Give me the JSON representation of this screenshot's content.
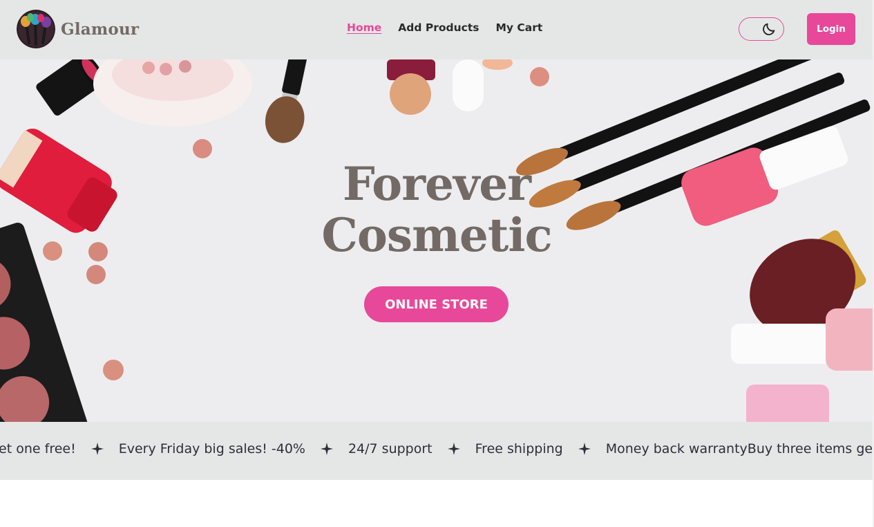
{
  "brand": {
    "name": "Glamour",
    "logo_icon": "makeup-brushes-logo"
  },
  "nav": {
    "links": [
      {
        "label": "Home",
        "active": true
      },
      {
        "label": "Add Products",
        "active": false
      },
      {
        "label": "My Cart",
        "active": false
      }
    ],
    "theme_toggle_icon": "moon-icon",
    "login_label": "Login"
  },
  "hero": {
    "title_line1": "Forever",
    "title_line2": "Cosmetic",
    "cta_label": "ONLINE STORE"
  },
  "marquee": {
    "items": [
      "get one free!",
      "Every Friday big sales! -40%",
      "24/7 support",
      "Free shipping",
      "Money back warrantyBuy three items get"
    ],
    "separator_icon": "sparkle-icon"
  },
  "colors": {
    "accent": "#e8489a",
    "brand_text": "#736a65",
    "navbar_bg": "#e5e7e6",
    "hero_bg": "#ededf0"
  }
}
